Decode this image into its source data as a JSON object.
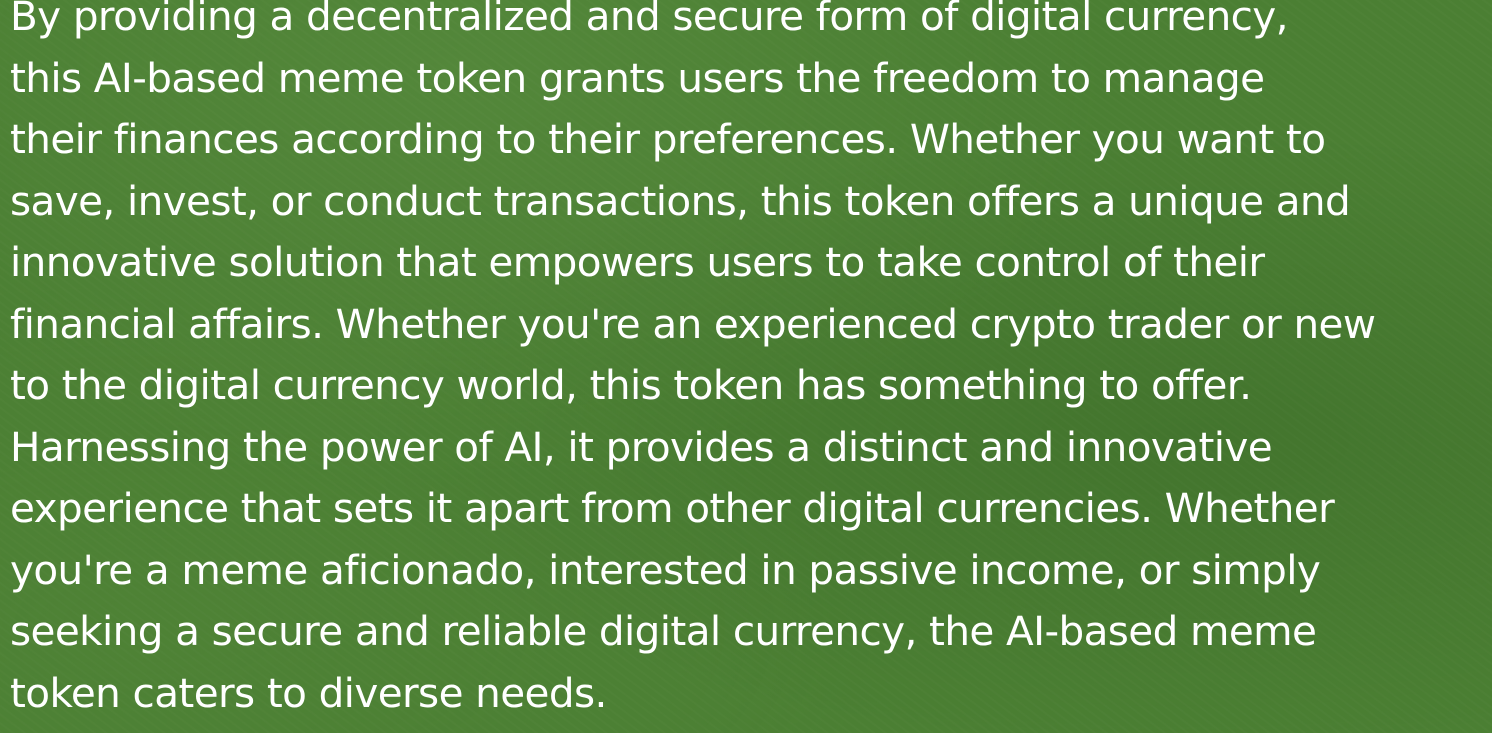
{
  "background_color": "#4b7f33",
  "text_color": "#ffffff",
  "article": {
    "lines": [
      "By providing a decentralized and secure form of digital currency,",
      "this AI-based meme token grants users the freedom to manage",
      "their finances according to their preferences. Whether you want to",
      "save, invest, or conduct transactions, this token offers a unique and",
      "innovative solution that empowers users to take control of their",
      "financial affairs. Whether you're an experienced crypto trader or new",
      "to the digital currency world, this token has something to offer.",
      "Harnessing the power of AI, it provides a distinct and innovative",
      "experience that sets it apart from other digital currencies. Whether",
      "you're a meme aficionado, interested in passive income, or simply",
      "seeking a secure and reliable digital currency, the AI-based meme",
      "token caters to diverse needs."
    ]
  }
}
